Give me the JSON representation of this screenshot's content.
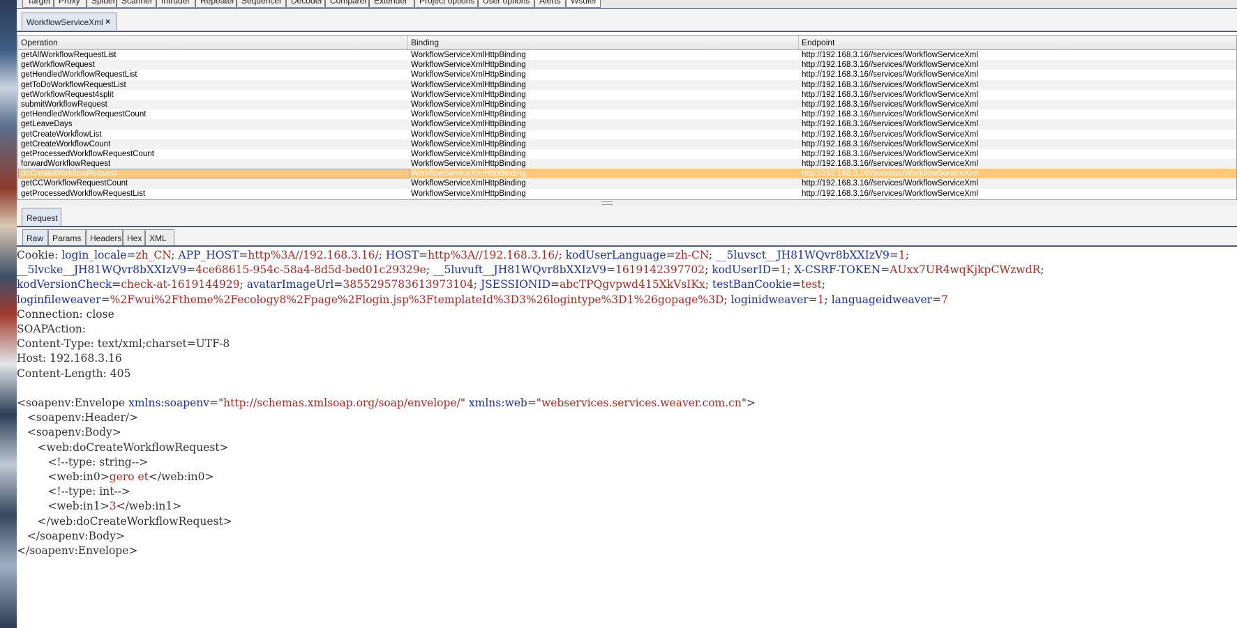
{
  "top_tabs": [
    "Target",
    "Proxy",
    "Spider",
    "Scanner",
    "Intruder",
    "Repeater",
    "Sequencer",
    "Decoder",
    "Comparer",
    "Extender",
    "Project options",
    "User options",
    "Alerts",
    "Wsdler"
  ],
  "sub_tab": {
    "label": "WorkflowServiceXml",
    "close": "×"
  },
  "table": {
    "headers": [
      "Operation",
      "Binding",
      "Endpoint"
    ],
    "rows": [
      [
        "getAllWorkflowRequestList",
        "WorkflowServiceXmlHttpBinding",
        "http://192.168.3.16//services/WorkflowServiceXml"
      ],
      [
        "getWorkflowRequest",
        "WorkflowServiceXmlHttpBinding",
        "http://192.168.3.16//services/WorkflowServiceXml"
      ],
      [
        "getHendledWorkflowRequestList",
        "WorkflowServiceXmlHttpBinding",
        "http://192.168.3.16//services/WorkflowServiceXml"
      ],
      [
        "getToDoWorkflowRequestList",
        "WorkflowServiceXmlHttpBinding",
        "http://192.168.3.16//services/WorkflowServiceXml"
      ],
      [
        "getWorkflowRequest4split",
        "WorkflowServiceXmlHttpBinding",
        "http://192.168.3.16//services/WorkflowServiceXml"
      ],
      [
        "submitWorkflowRequest",
        "WorkflowServiceXmlHttpBinding",
        "http://192.168.3.16//services/WorkflowServiceXml"
      ],
      [
        "getHendledWorkflowRequestCount",
        "WorkflowServiceXmlHttpBinding",
        "http://192.168.3.16//services/WorkflowServiceXml"
      ],
      [
        "getLeaveDays",
        "WorkflowServiceXmlHttpBinding",
        "http://192.168.3.16//services/WorkflowServiceXml"
      ],
      [
        "getCreateWorkflowList",
        "WorkflowServiceXmlHttpBinding",
        "http://192.168.3.16//services/WorkflowServiceXml"
      ],
      [
        "getCreateWorkflowCount",
        "WorkflowServiceXmlHttpBinding",
        "http://192.168.3.16//services/WorkflowServiceXml"
      ],
      [
        "getProcessedWorkflowRequestCount",
        "WorkflowServiceXmlHttpBinding",
        "http://192.168.3.16//services/WorkflowServiceXml"
      ],
      [
        "forwardWorkflowRequest",
        "WorkflowServiceXmlHttpBinding",
        "http://192.168.3.16//services/WorkflowServiceXml"
      ],
      [
        "doCreateWorkflowRequest",
        "WorkflowServiceXmlHttpBinding",
        "http://192.168.3.16//services/WorkflowServiceXml"
      ],
      [
        "getCCWorkflowRequestCount",
        "WorkflowServiceXmlHttpBinding",
        "http://192.168.3.16//services/WorkflowServiceXml"
      ],
      [
        "getProcessedWorkflowRequestList",
        "WorkflowServiceXmlHttpBinding",
        "http://192.168.3.16//services/WorkflowServiceXml"
      ]
    ],
    "selected_row": 12
  },
  "request_tab": "Request",
  "view_tabs": [
    "Raw",
    "Params",
    "Headers",
    "Hex",
    "XML"
  ],
  "editor_lines": [
    [
      [
        "t",
        "Cookie: "
      ],
      [
        "k",
        "login_locale"
      ],
      [
        "t",
        "="
      ],
      [
        "v",
        "zh_CN"
      ],
      [
        "t",
        "; "
      ],
      [
        "k",
        "APP_HOST"
      ],
      [
        "t",
        "="
      ],
      [
        "v",
        "http%3A//192.168.3.16/"
      ],
      [
        "t",
        "; "
      ],
      [
        "k",
        "HOST"
      ],
      [
        "t",
        "="
      ],
      [
        "v",
        "http%3A//192.168.3.16/"
      ],
      [
        "t",
        "; "
      ],
      [
        "k",
        "kodUserLanguage"
      ],
      [
        "t",
        "="
      ],
      [
        "v",
        "zh-CN"
      ],
      [
        "t",
        "; "
      ],
      [
        "k",
        "__5luvsct__JH81WQvr8bXXIzV9"
      ],
      [
        "t",
        "="
      ],
      [
        "v",
        "1"
      ],
      [
        "t",
        ";"
      ]
    ],
    [
      [
        "k",
        "__5lvcke__JH81WQvr8bXXIzV9"
      ],
      [
        "t",
        "="
      ],
      [
        "v",
        "4ce68615-954c-58a4-8d5d-bed01c29329e"
      ],
      [
        "t",
        "; "
      ],
      [
        "k",
        "__5luvuft__JH81WQvr8bXXIzV9"
      ],
      [
        "t",
        "="
      ],
      [
        "v",
        "1619142397702"
      ],
      [
        "t",
        "; "
      ],
      [
        "k",
        "kodUserID"
      ],
      [
        "t",
        "="
      ],
      [
        "v",
        "1"
      ],
      [
        "t",
        "; "
      ],
      [
        "k",
        "X-CSRF-TOKEN"
      ],
      [
        "t",
        "="
      ],
      [
        "v",
        "AUxx7UR4wqKjkpCWzwdR"
      ],
      [
        "t",
        ";"
      ]
    ],
    [
      [
        "k",
        "kodVersionCheck"
      ],
      [
        "t",
        "="
      ],
      [
        "v",
        "check-at-1619144929"
      ],
      [
        "t",
        "; "
      ],
      [
        "k",
        "avatarImageUrl"
      ],
      [
        "t",
        "="
      ],
      [
        "v",
        "3855295783613973104"
      ],
      [
        "t",
        "; "
      ],
      [
        "k",
        "JSESSIONID"
      ],
      [
        "t",
        "="
      ],
      [
        "v",
        "abcTPQgvpwd415XkVsIKx"
      ],
      [
        "t",
        "; "
      ],
      [
        "k",
        "testBanCookie"
      ],
      [
        "t",
        "="
      ],
      [
        "v",
        "test"
      ],
      [
        "t",
        ";"
      ]
    ],
    [
      [
        "k",
        "loginfileweaver"
      ],
      [
        "t",
        "="
      ],
      [
        "v",
        "%2Fwui%2Ftheme%2Fecology8%2Fpage%2Flogin.jsp%3FtemplateId%3D3%26logintype%3D1%26gopage%3D"
      ],
      [
        "t",
        "; "
      ],
      [
        "k",
        "loginidweaver"
      ],
      [
        "t",
        "="
      ],
      [
        "v",
        "1"
      ],
      [
        "t",
        "; "
      ],
      [
        "k",
        "languageidweaver"
      ],
      [
        "t",
        "="
      ],
      [
        "v",
        "7"
      ]
    ],
    [
      [
        "t",
        "Connection: close"
      ]
    ],
    [
      [
        "t",
        "SOAPAction: "
      ]
    ],
    [
      [
        "t",
        "Content-Type: text/xml;charset=UTF-8"
      ]
    ],
    [
      [
        "t",
        "Host: 192.168.3.16"
      ]
    ],
    [
      [
        "t",
        "Content-Length: 405"
      ]
    ],
    [],
    [
      [
        "t",
        "<soapenv:Envelope "
      ],
      [
        "k",
        "xmlns:soapenv"
      ],
      [
        "t",
        "=\""
      ],
      [
        "v",
        "http://schemas.xmlsoap.org/soap/envelope/"
      ],
      [
        "t",
        "\" "
      ],
      [
        "k",
        "xmlns:web"
      ],
      [
        "t",
        "=\""
      ],
      [
        "v",
        "webservices.services.weaver.com.cn"
      ],
      [
        "t",
        "\">"
      ]
    ],
    [
      [
        "t",
        "   <soapenv:Header/>"
      ]
    ],
    [
      [
        "t",
        "   <soapenv:Body>"
      ]
    ],
    [
      [
        "t",
        "      <web:doCreateWorkflowRequest>"
      ]
    ],
    [
      [
        "t",
        "         <!--type: string-->"
      ]
    ],
    [
      [
        "t",
        "         <web:in0>"
      ],
      [
        "v",
        "gero et"
      ],
      [
        "t",
        "</web:in0>"
      ]
    ],
    [
      [
        "t",
        "         <!--type: int-->"
      ]
    ],
    [
      [
        "t",
        "         <web:in1>"
      ],
      [
        "v",
        "3"
      ],
      [
        "t",
        "</web:in1>"
      ]
    ],
    [
      [
        "t",
        "      </web:doCreateWorkflowRequest>"
      ]
    ],
    [
      [
        "t",
        "   </soapenv:Body>"
      ]
    ],
    [
      [
        "t",
        "</soapenv:Envelope>"
      ]
    ]
  ]
}
